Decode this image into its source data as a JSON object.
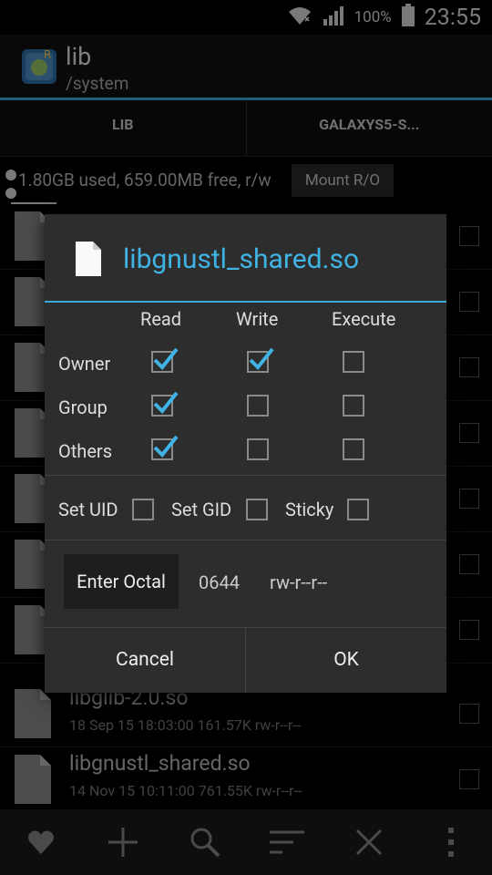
{
  "status_bar": {
    "battery_text": "100%",
    "time": "23:55"
  },
  "app_bar": {
    "title": "lib",
    "subtitle": "/system"
  },
  "tabs": [
    {
      "label": "LIB",
      "active": true
    },
    {
      "label": "GALAXYS5-S...",
      "active": false
    }
  ],
  "storage": {
    "text": "1.80GB used, 659.00MB free, r/w",
    "mount_button": "Mount R/O"
  },
  "file_list": [
    {
      "name": "",
      "meta": ""
    },
    {
      "name": "",
      "meta": ""
    },
    {
      "name": "",
      "meta": ""
    },
    {
      "name": "",
      "meta": ""
    },
    {
      "name": "",
      "meta": ""
    },
    {
      "name": "",
      "meta": ""
    },
    {
      "name": "",
      "meta": ""
    },
    {
      "name": "libglib-2.0.so",
      "meta": "18 Sep 15 18:03:00  161.57K  rw-r--r--"
    },
    {
      "name": "libgnustl_shared.so",
      "meta": "14 Nov 15 10:11:00  761.55K  rw-r--r--"
    }
  ],
  "dialog": {
    "title": "libgnustl_shared.so",
    "columns": [
      "Read",
      "Write",
      "Execute"
    ],
    "rows": [
      {
        "label": "Owner",
        "read": true,
        "write": true,
        "execute": false
      },
      {
        "label": "Group",
        "read": true,
        "write": false,
        "execute": false
      },
      {
        "label": "Others",
        "read": true,
        "write": false,
        "execute": false
      }
    ],
    "special": {
      "setuid_label": "Set UID",
      "setgid_label": "Set GID",
      "sticky_label": "Sticky"
    },
    "octal": {
      "button_label": "Enter Octal",
      "value": "0644",
      "string": "rw-r--r--"
    },
    "cancel_label": "Cancel",
    "ok_label": "OK"
  },
  "colors": {
    "accent": "#3aa9d8",
    "dialog_bg": "#2d2d2d"
  },
  "bottom_bar_icons": [
    "heart-icon",
    "plus-icon",
    "search-icon",
    "sort-icon",
    "close-icon",
    "overflow-menu-icon"
  ]
}
